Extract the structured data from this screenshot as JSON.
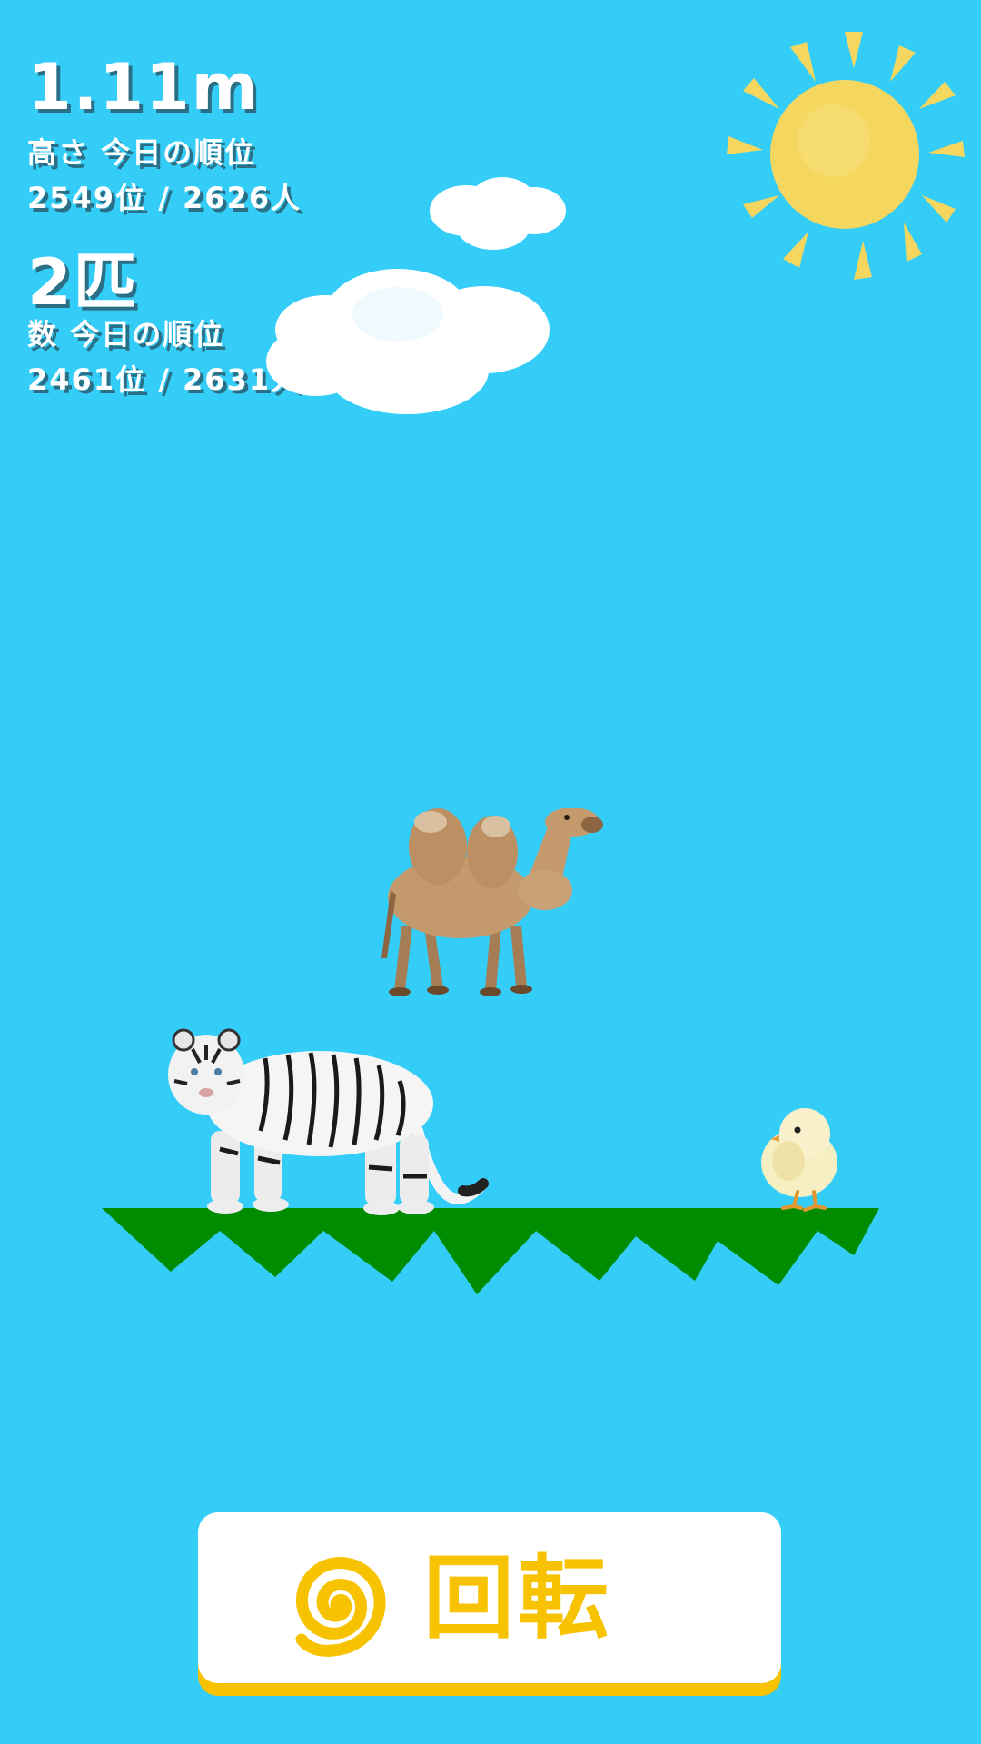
{
  "stats": {
    "height_value": "1.11m",
    "height_rank_label": "高さ 今日の順位",
    "height_rank": "2549位 / 2626人",
    "count_value": "2匹",
    "count_rank_label": "数 今日の順位",
    "count_rank": "2461位 / 2631人"
  },
  "button": {
    "label": "回転",
    "icon": "spiral-icon"
  },
  "animals": [
    "camel",
    "white-tiger",
    "chick"
  ],
  "colors": {
    "sky": "#33cdf8",
    "ground": "#008c00",
    "accent": "#f7c300",
    "sun": "#f5d65f"
  }
}
